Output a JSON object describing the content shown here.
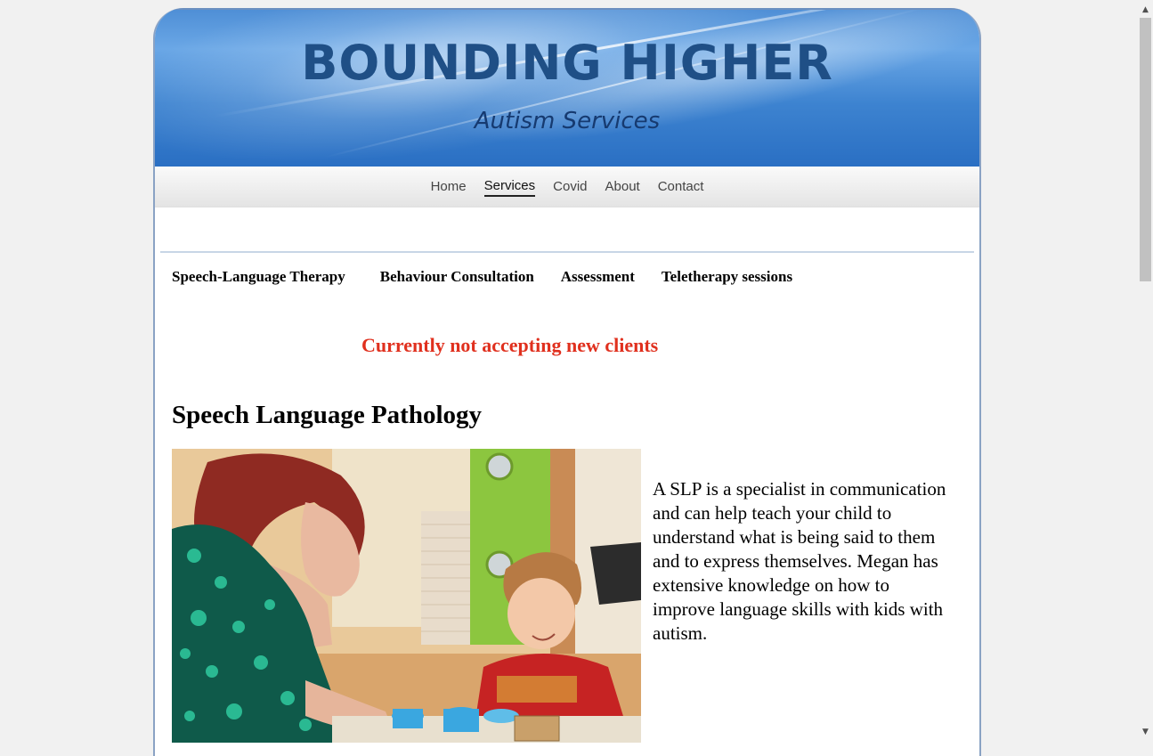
{
  "header": {
    "title": "BOUNDING HIGHER",
    "subtitle": "Autism Services"
  },
  "nav": {
    "items": [
      {
        "label": "Home"
      },
      {
        "label": "Services",
        "active": true
      },
      {
        "label": "Covid"
      },
      {
        "label": "About"
      },
      {
        "label": "Contact"
      }
    ]
  },
  "subnav": {
    "items": [
      {
        "label": "Speech-Language Therapy"
      },
      {
        "label": "Behaviour Consultation"
      },
      {
        "label": "Assessment"
      },
      {
        "label": "Teletherapy sessions"
      }
    ]
  },
  "notice": "Currently not accepting new clients",
  "section": {
    "heading": "Speech Language Pathology",
    "description": "A SLP is a specialist in communication and can help teach your child to understand what is being said to them and to express themselves.  Megan has extensive knowledge on how to improve language skills with kids with autism."
  },
  "colors": {
    "header_blue": "#2a6fc3",
    "title_blue": "#1f4f86",
    "notice_red": "#e0301e"
  },
  "scrollbar": {
    "up_icon": "triangle-up",
    "down_icon": "triangle-down"
  }
}
